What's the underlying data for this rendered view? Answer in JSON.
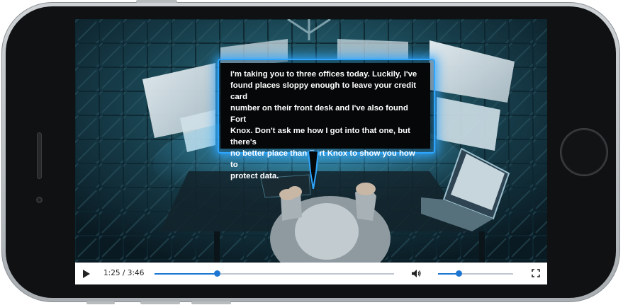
{
  "caption": {
    "lines": [
      "I'm taking you to three offices today. Luckily, I've",
      "found places sloppy enough to leave your credit card",
      "number on their front desk and I've also found Fort",
      "Knox. Don't ask me how I got into that one, but there's",
      "no better place than Fort Knox to show you how to",
      "protect data."
    ]
  },
  "player": {
    "time_display": "1:25 / 3:46",
    "progress": 0.26,
    "volume": 0.27,
    "controls": {
      "play_icon": "play-icon",
      "volume_icon": "volume-icon",
      "fullscreen_icon": "fullscreen-icon"
    },
    "colors": {
      "accent": "#1c76d2",
      "track": "#bfc7d1",
      "caption_glow": "#2ea6ff"
    }
  }
}
